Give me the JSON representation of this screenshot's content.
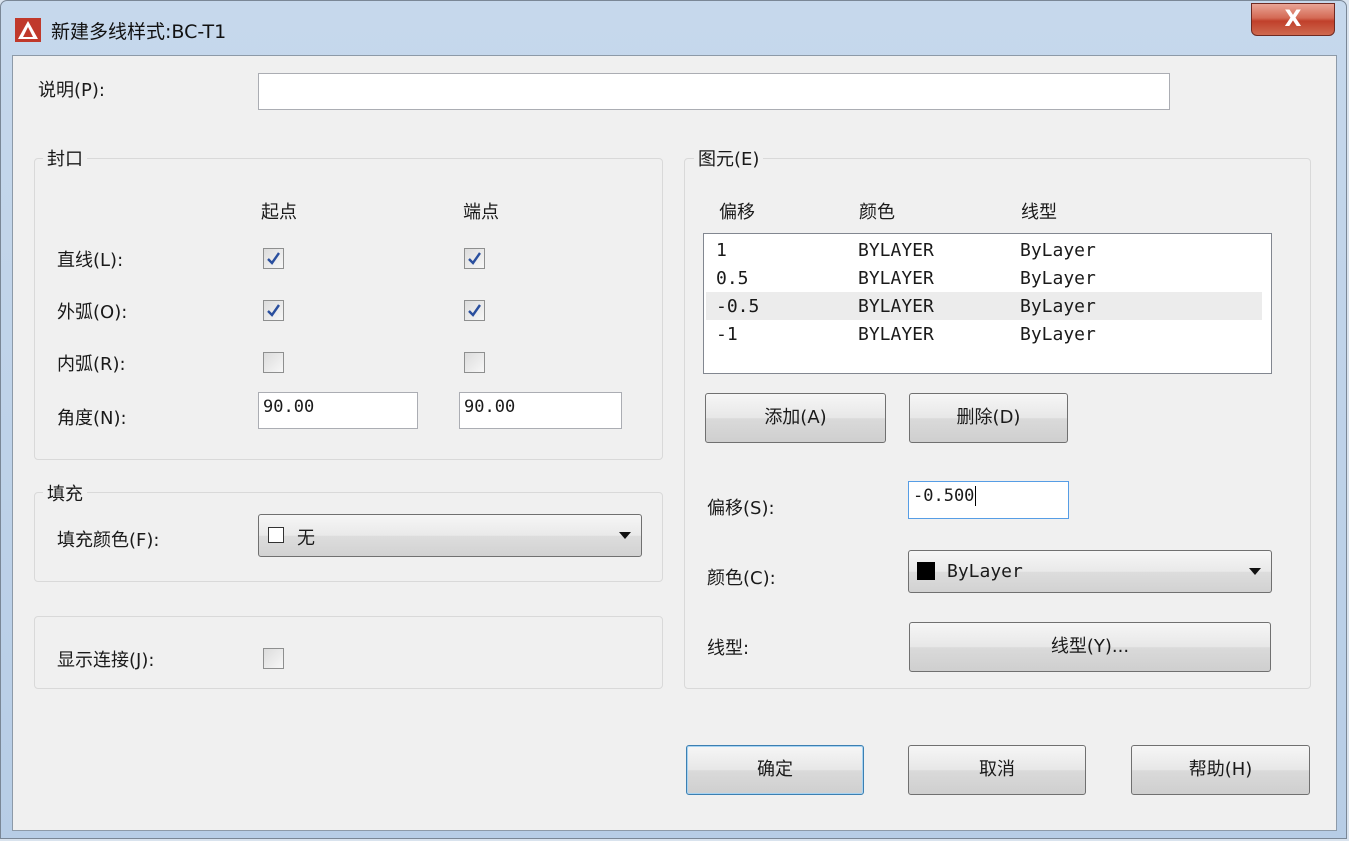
{
  "window": {
    "title": "新建多线样式:BC-T1",
    "close_label": "X"
  },
  "description": {
    "label": "说明(P):",
    "value": ""
  },
  "caps": {
    "title": "封口",
    "col_start": "起点",
    "col_end": "端点",
    "rows": [
      {
        "label": "直线(L):",
        "start": true,
        "end": true
      },
      {
        "label": "外弧(O):",
        "start": true,
        "end": true
      },
      {
        "label": "内弧(R):",
        "start": false,
        "end": false
      }
    ],
    "angle_label": "角度(N):",
    "angle_start": "90.00",
    "angle_end": "90.00"
  },
  "fill": {
    "title": "填充",
    "color_label": "填充颜色(F):",
    "color_value": "无"
  },
  "joints": {
    "label": "显示连接(J):",
    "checked": false
  },
  "elements": {
    "title": "图元(E)",
    "headers": [
      "偏移",
      "颜色",
      "线型"
    ],
    "rows": [
      {
        "offset": "1",
        "color": "BYLAYER",
        "linetype": "ByLayer"
      },
      {
        "offset": "0.5",
        "color": "BYLAYER",
        "linetype": "ByLayer"
      },
      {
        "offset": "-0.5",
        "color": "BYLAYER",
        "linetype": "ByLayer"
      },
      {
        "offset": "-1",
        "color": "BYLAYER",
        "linetype": "ByLayer"
      }
    ],
    "selected_index": 2,
    "add_label": "添加(A)",
    "delete_label": "删除(D)",
    "offset_label": "偏移(S):",
    "offset_value": "-0.500",
    "color_label": "颜色(C):",
    "color_value": "ByLayer",
    "color_swatch": "#000000",
    "linetype_label": "线型:",
    "linetype_button": "线型(Y)..."
  },
  "buttons": {
    "ok": "确定",
    "cancel": "取消",
    "help": "帮助(H)"
  },
  "colors": {
    "check": "#2a4f9e",
    "default_border": "#3c7fb1"
  }
}
